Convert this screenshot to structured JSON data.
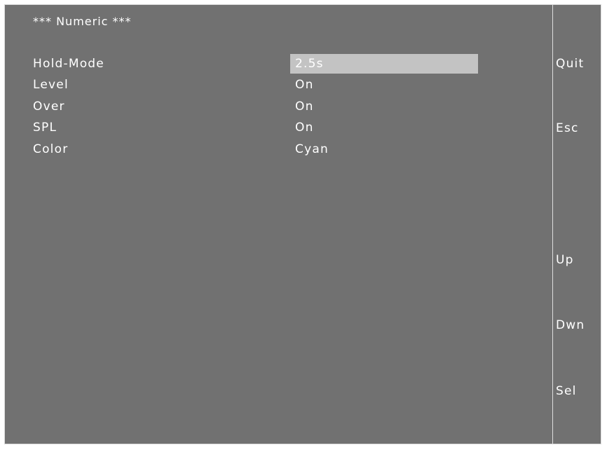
{
  "menu": {
    "title": "*** Numeric ***",
    "items": [
      {
        "label": "Hold-Mode",
        "value": "2.5s",
        "selected": true
      },
      {
        "label": "Level",
        "value": "On"
      },
      {
        "label": "Over",
        "value": "On"
      },
      {
        "label": "SPL",
        "value": "On"
      },
      {
        "label": "Color",
        "value": "Cyan"
      }
    ]
  },
  "softkeys": {
    "quit": "Quit",
    "esc": "Esc",
    "up": "Up",
    "down": "Dwn",
    "select": "Sel"
  },
  "colors": {
    "screen_background": "#717171",
    "selection_highlight": "#c3c3c3",
    "text": "#ffffff"
  }
}
